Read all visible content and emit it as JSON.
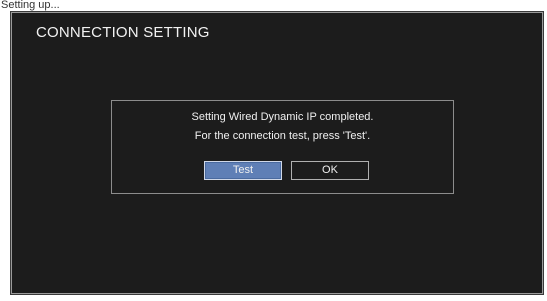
{
  "caption": "Setting up...",
  "screen": {
    "title": "CONNECTION SETTING"
  },
  "dialog": {
    "line1": "Setting Wired Dynamic IP completed.",
    "line2": "For the connection test, press 'Test'.",
    "buttons": {
      "test": "Test",
      "ok": "OK"
    },
    "selected_button": "test"
  },
  "colors": {
    "screen_bg": "#1c1c1c",
    "selected_button_bg": "#5f7fb6",
    "text": "#f0f0f0"
  }
}
